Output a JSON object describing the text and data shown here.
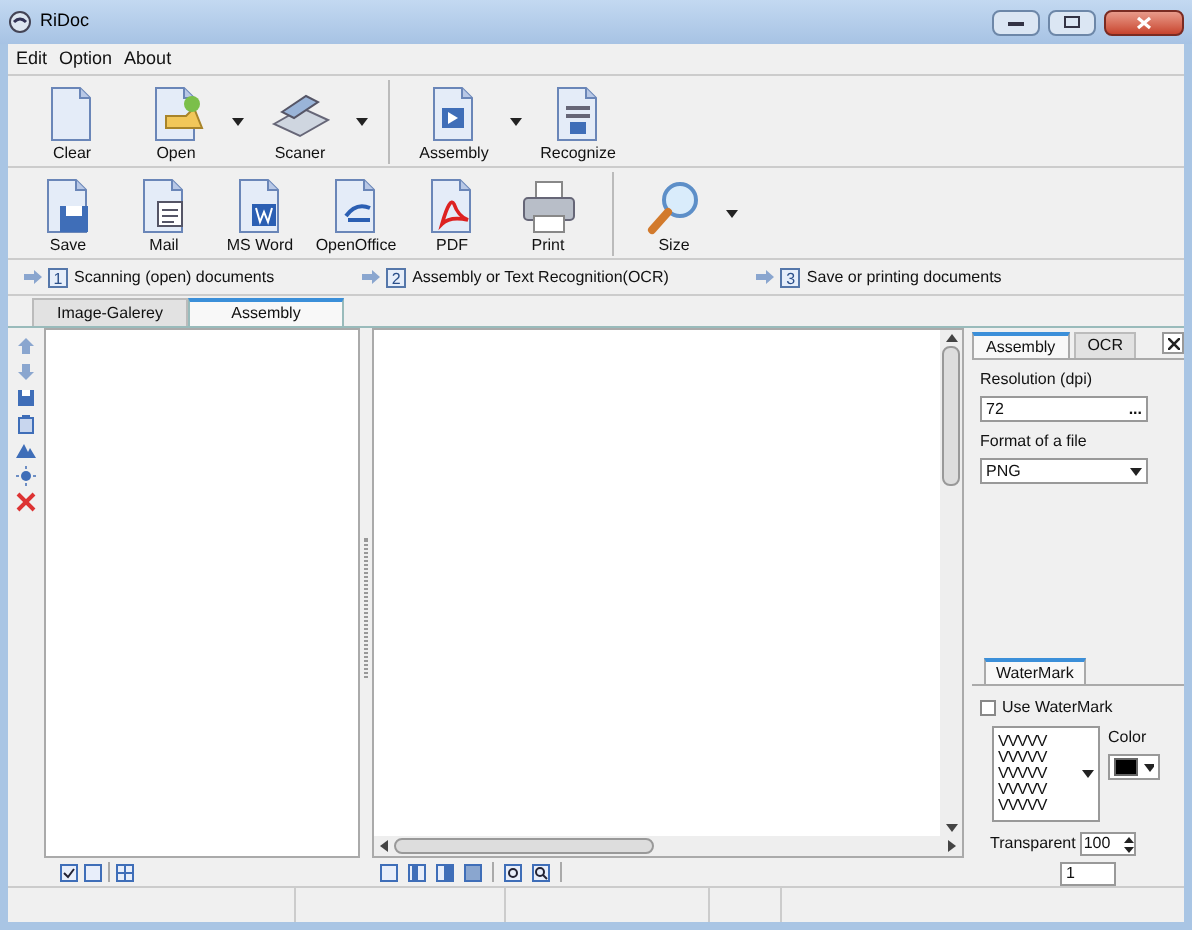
{
  "window": {
    "title": "RiDoc"
  },
  "menu": [
    "Edit",
    "Option",
    "About"
  ],
  "toolbar_main": [
    {
      "buttons": [
        {
          "label": "Clear",
          "kind": "clear",
          "dropdown": false
        },
        {
          "label": "Open",
          "kind": "open",
          "dropdown": true
        },
        {
          "label": "Scaner",
          "kind": "scanner",
          "dropdown": true
        }
      ]
    },
    {
      "buttons": [
        {
          "label": "Assembly",
          "kind": "assembly",
          "dropdown": true
        },
        {
          "label": "Recognize",
          "kind": "recognize",
          "dropdown": false
        }
      ]
    }
  ],
  "toolbar_output": [
    {
      "buttons": [
        {
          "label": "Save",
          "kind": "save",
          "dropdown": false
        },
        {
          "label": "Mail",
          "kind": "mail",
          "dropdown": false
        },
        {
          "label": "MS Word",
          "kind": "word",
          "dropdown": false
        },
        {
          "label": "OpenOffice",
          "kind": "openoffice",
          "dropdown": false
        },
        {
          "label": "PDF",
          "kind": "pdf",
          "dropdown": false
        },
        {
          "label": "Print",
          "kind": "print",
          "dropdown": false
        }
      ]
    },
    {
      "buttons": [
        {
          "label": "Size",
          "kind": "zoom",
          "dropdown": true
        }
      ]
    }
  ],
  "steps": [
    {
      "number": "1",
      "label": "Scanning (open) documents"
    },
    {
      "number": "2",
      "label": "Assembly or Text Recognition(OCR)"
    },
    {
      "number": "3",
      "label": "Save or printing documents"
    }
  ],
  "tabs": [
    {
      "label": "Image-Galerey",
      "selected": false
    },
    {
      "label": "Assembly",
      "selected": true
    }
  ],
  "side_panel": {
    "tabs": [
      {
        "label": "Assembly",
        "selected": true
      },
      {
        "label": "OCR",
        "selected": false
      }
    ],
    "resolution": {
      "label": "Resolution (dpi)",
      "value": "72",
      "button": "..."
    },
    "format": {
      "label": "Format of a file",
      "value": "PNG"
    }
  },
  "watermark": {
    "tab": "WaterMark",
    "use": {
      "label": "Use WaterMark",
      "checked": false
    },
    "pattern": [
      "VVVVV",
      "VVVVV",
      "VVVVV",
      "VVVVV",
      "VVVVV"
    ],
    "color_label": "Color",
    "color": "#000000",
    "transparent": {
      "label": "Transparent",
      "value": "100"
    },
    "size_value": "1"
  }
}
